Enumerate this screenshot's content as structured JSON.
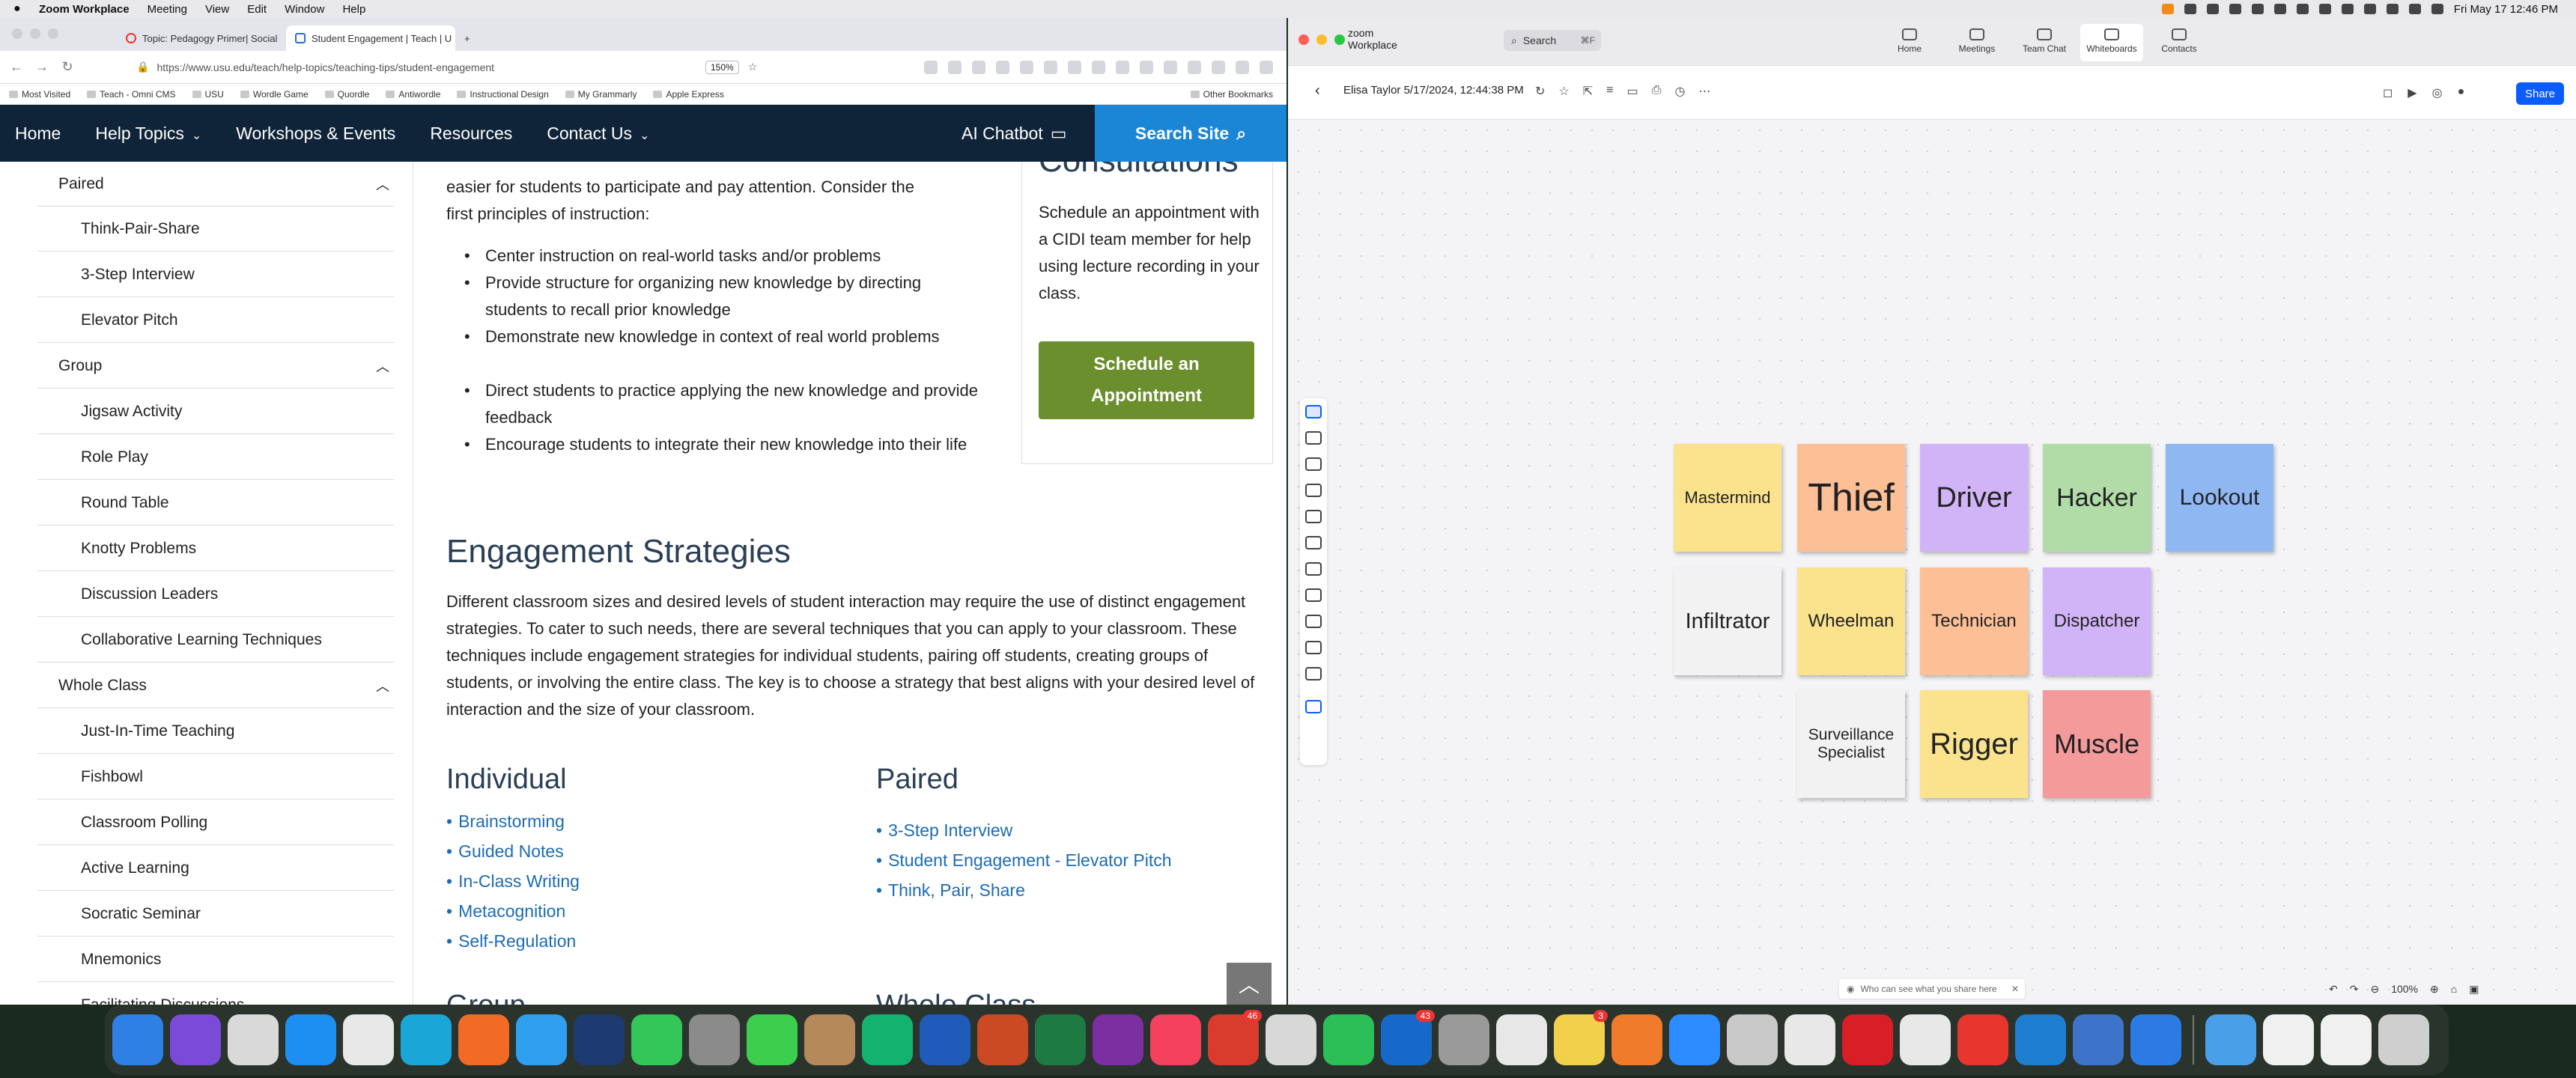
{
  "menubar": {
    "app_name": "Zoom Workplace",
    "items": [
      "Meeting",
      "View",
      "Edit",
      "Window",
      "Help"
    ],
    "datetime": "Fri May 17  12:46 PM"
  },
  "browser": {
    "tabs": [
      {
        "label": "Topic: Pedagogy Primer| Social"
      },
      {
        "label": "Student Engagement | Teach | U"
      }
    ],
    "url": "https://www.usu.edu/teach/help-topics/teaching-tips/student-engagement",
    "zoom": "150%",
    "bookmarks": [
      "Most Visited",
      "Teach - Omni CMS",
      "USU",
      "Wordle Game",
      "Quordle",
      "Antiwordle",
      "Instructional Design",
      "My Grammarly",
      "Apple Express"
    ],
    "other_bookmarks": "Other Bookmarks"
  },
  "site_nav": {
    "items": [
      "Home",
      "Help Topics",
      "Workshops & Events",
      "Resources",
      "Contact Us"
    ],
    "chatbot": "AI Chatbot",
    "search": "Search Site"
  },
  "sidebar": {
    "paired": {
      "heading": "Paired",
      "items": [
        "Think-Pair-Share",
        "3-Step Interview",
        "Elevator Pitch"
      ]
    },
    "group": {
      "heading": "Group",
      "items": [
        "Jigsaw Activity",
        "Role Play",
        "Round Table",
        "Knotty Problems",
        "Discussion Leaders",
        "Collaborative Learning Techniques"
      ]
    },
    "whole_class": {
      "heading": "Whole Class",
      "items": [
        "Just-In-Time Teaching",
        "Fishbowl",
        "Classroom Polling",
        "Active Learning",
        "Socratic Seminar",
        "Mnemonics",
        "Facilitating Discussions"
      ]
    }
  },
  "main": {
    "intro_line1": "easier for students to participate and pay attention. Consider the",
    "intro_line2": "first principles of instruction:",
    "principles": [
      "Center instruction on real-world tasks and/or problems",
      "Provide structure for organizing new knowledge by directing students to recall prior knowledge",
      "Demonstrate new knowledge in context of real world problems",
      "Direct students to practice applying the new knowledge and provide feedback",
      "Encourage students to integrate their new knowledge into their life"
    ],
    "consult_heading": "Consultations",
    "consult_text": "Schedule an appointment with a CIDI team member for help using lecture recording in your class.",
    "consult_button": "Schedule an Appointment",
    "strategies_heading": "Engagement Strategies",
    "strategies_text": "Different classroom sizes and desired levels of student interaction may require the use of distinct engagement strategies. To cater to such needs, there are several techniques that you can apply to your classroom. These techniques include engagement strategies for individual students, pairing off students, creating groups of students, or involving the entire class. The key is to choose a strategy that best aligns with your desired level of interaction and the size of your classroom.",
    "individual_heading": "Individual",
    "individual_links": [
      "Brainstorming",
      "Guided Notes",
      "In-Class Writing",
      "Metacognition",
      "Self-Regulation"
    ],
    "paired_heading": "Paired",
    "paired_links": [
      "3-Step Interview",
      "Student Engagement - Elevator Pitch",
      "Think, Pair, Share"
    ],
    "group_heading": "Group",
    "whole_class_heading": "Whole Class"
  },
  "zoom": {
    "brand_line1": "zoom",
    "brand_line2": "Workplace",
    "search": "Search",
    "search_shortcut": "⌘F",
    "tabs": [
      "Home",
      "Meetings",
      "Team Chat",
      "Whiteboards",
      "Contacts"
    ],
    "whiteboard_title": "Elisa Taylor 5/17/2024, 12:44:38 PM",
    "share": "Share",
    "notes": [
      {
        "label": "Mastermind",
        "color": "#fbe38e"
      },
      {
        "label": "Thief",
        "color": "#fdbf96"
      },
      {
        "label": "Driver",
        "color": "#d1b3f7"
      },
      {
        "label": "Hacker",
        "color": "#b1dca8"
      },
      {
        "label": "Lookout",
        "color": "#8fb7f2"
      },
      {
        "label": "Infiltrator",
        "color": "#f2f2f2"
      },
      {
        "label": "Wheelman",
        "color": "#fbe38e"
      },
      {
        "label": "Technician",
        "color": "#fdbf96"
      },
      {
        "label": "Dispatcher",
        "color": "#d1b3f7"
      },
      {
        "label": "Surveillance Specialist",
        "color": "#f2f2f2"
      },
      {
        "label": "Rigger",
        "color": "#fbe38e"
      },
      {
        "label": "Muscle",
        "color": "#f59a9a"
      }
    ],
    "who_can_see": "Who can see what you share here",
    "zoom_level": "100%"
  },
  "dock": {
    "badges": {
      "wunderbucket": "46",
      "outlook": "43",
      "affinity": "3"
    }
  }
}
